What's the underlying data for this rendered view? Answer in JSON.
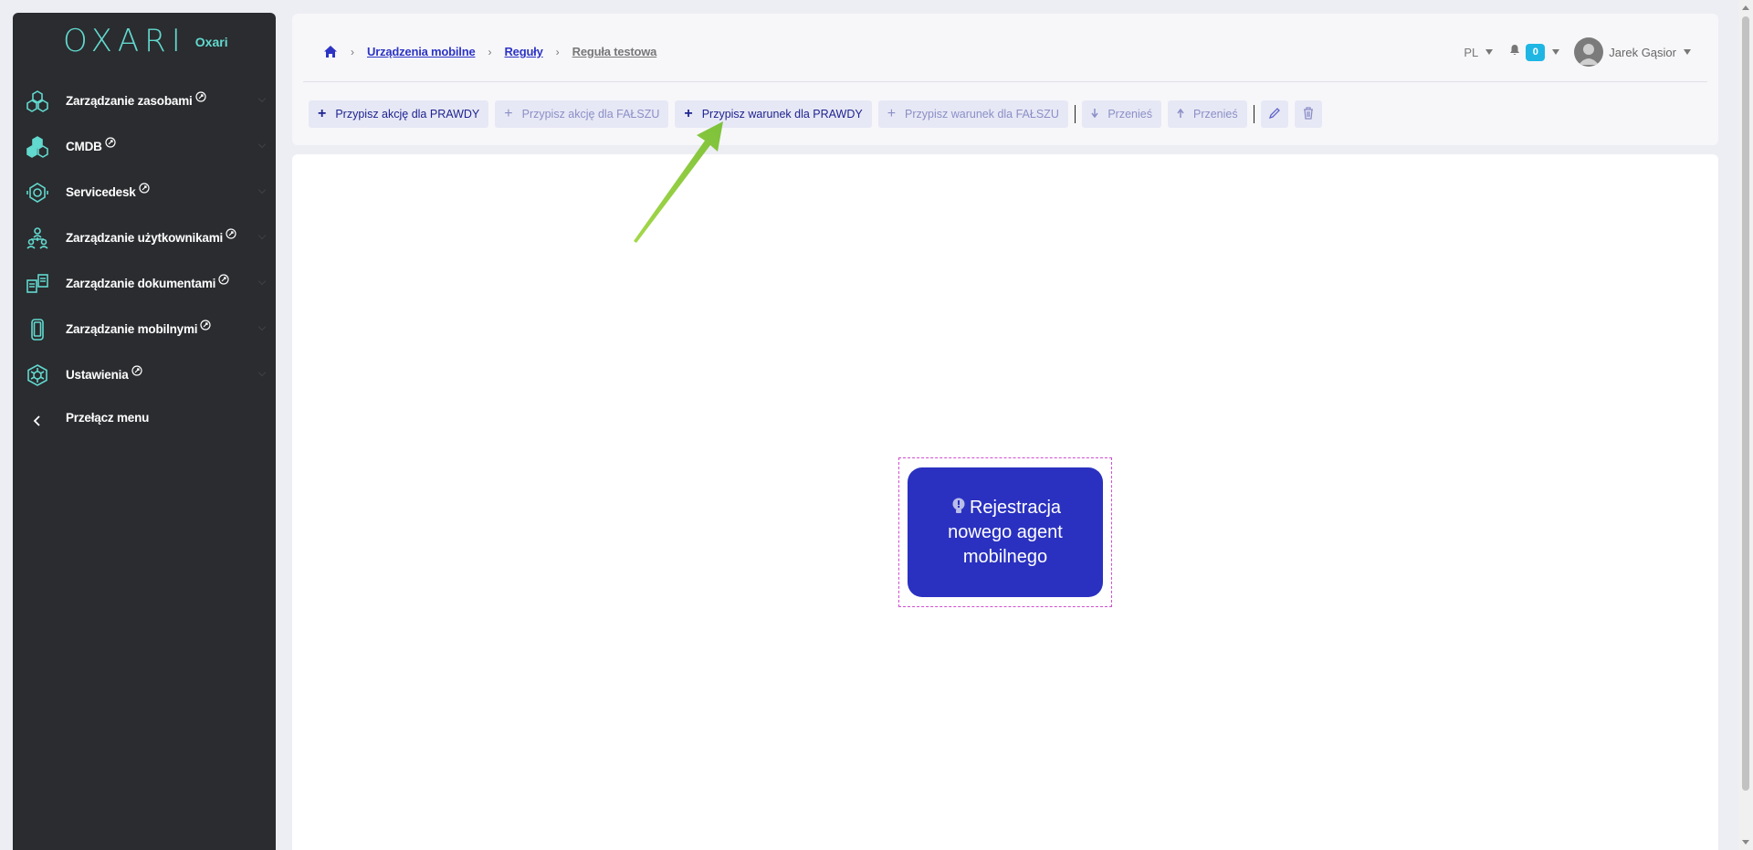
{
  "sidebar": {
    "logo_mark": "OXARI",
    "logo_name": "Oxari",
    "items": [
      {
        "label": "Zarządzanie zasobami",
        "icon": "assets-icon"
      },
      {
        "label": "CMDB",
        "icon": "cmdb-icon"
      },
      {
        "label": "Servicedesk",
        "icon": "servicedesk-icon"
      },
      {
        "label": "Zarządzanie użytkownikami",
        "icon": "users-icon"
      },
      {
        "label": "Zarządzanie dokumentami",
        "icon": "documents-icon"
      },
      {
        "label": "Zarządzanie mobilnymi",
        "icon": "mobile-icon"
      },
      {
        "label": "Ustawienia",
        "icon": "settings-icon"
      }
    ],
    "toggle_label": "Przełącz menu"
  },
  "breadcrumb": {
    "items": [
      "Urządzenia mobilne",
      "Reguły"
    ],
    "current": "Reguła testowa"
  },
  "topbar": {
    "language": "PL",
    "notification_count": "0",
    "user_name": "Jarek Gąsior"
  },
  "toolbar": {
    "assign_action_true": "Przypisz akcję dla PRAWDY",
    "assign_action_false": "Przypisz akcję dla FAŁSZU",
    "assign_condition_true": "Przypisz warunek dla PRAWDY",
    "assign_condition_false": "Przypisz warunek dla FAŁSZU",
    "move_down": "Przenieś",
    "move_up": "Przenieś"
  },
  "rule_node": {
    "label": "Rejestracja nowego agent mobilnego"
  },
  "colors": {
    "accent": "#62d9cf",
    "primary": "#2a31c0",
    "sidebar_bg": "#2a2c2f",
    "annotation_arrow": "#8ccc3a"
  }
}
